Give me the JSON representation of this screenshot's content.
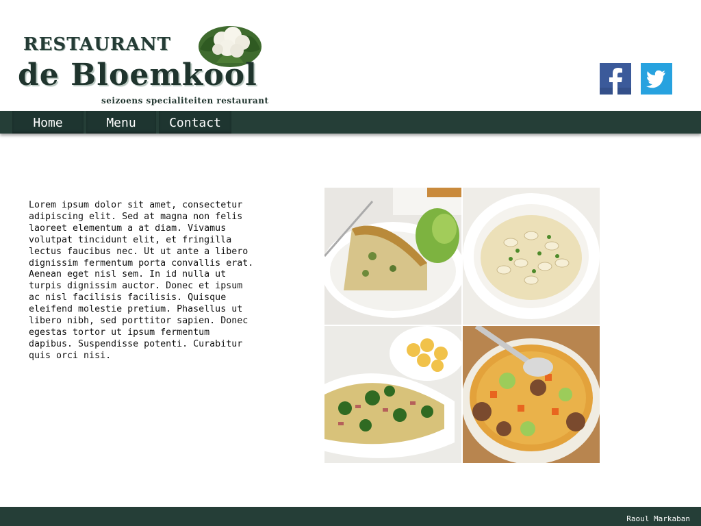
{
  "brand": {
    "line1": "RESTAURANT",
    "line2": "de Bloemkool",
    "tagline": "seizoens specialiteiten restaurant"
  },
  "social": [
    {
      "name": "Facebook",
      "icon": "facebook-icon",
      "color": "#3b5a9a"
    },
    {
      "name": "Twitter",
      "icon": "twitter-icon",
      "color": "#27a2df"
    }
  ],
  "nav": {
    "items": [
      {
        "label": "Home"
      },
      {
        "label": "Menu"
      },
      {
        "label": "Contact"
      }
    ],
    "background": "#253e37"
  },
  "main": {
    "text": "Lorem ipsum dolor sit amet, consectetur adipiscing elit. Sed at magna non felis laoreet elementum a at diam. Vivamus volutpat tincidunt elit, et fringilla lectus faucibus nec. Ut ut ante a libero dignissim fermentum porta convallis erat. Aenean eget nisl sem. In id nulla ut turpis dignissim auctor. Donec et ipsum ac nisl facilisis facilisis. Quisque eleifend molestie pretium. Phasellus ut libero nibh, sed porttitor sapien. Donec egestas tortor ut ipsum fermentum dapibus. Suspendisse potenti. Curabitur quis orci nisi."
  },
  "gallery": [
    {
      "subject": "quiche-photo"
    },
    {
      "subject": "pasta-salad-photo"
    },
    {
      "subject": "broccoli-rice-photo"
    },
    {
      "subject": "meatball-soup-photo"
    }
  ],
  "footer": {
    "author": "Raoul Markaban"
  }
}
